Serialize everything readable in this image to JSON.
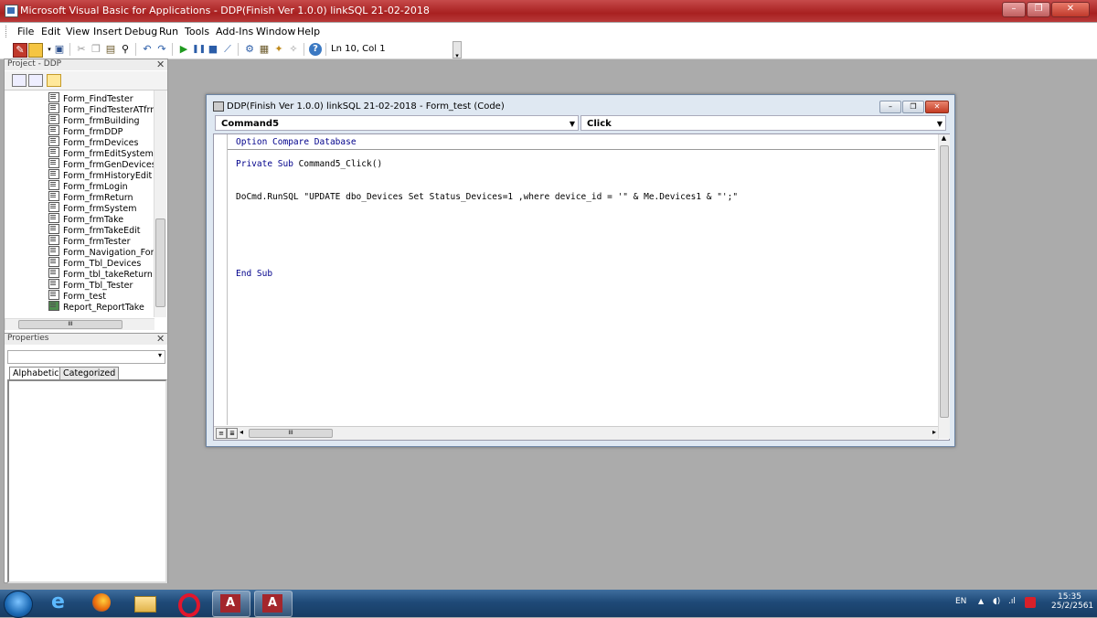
{
  "window": {
    "title": "Microsoft Visual Basic for Applications - DDP(Finish Ver 1.0.0) linkSQL 21-02-2018"
  },
  "menu": [
    "File",
    "Edit",
    "View",
    "Insert",
    "Debug",
    "Run",
    "Tools",
    "Add-Ins",
    "Window",
    "Help"
  ],
  "toolbar": {
    "position": "Ln 10, Col 1"
  },
  "project": {
    "title": "Project - DDP",
    "items": [
      "Form_FindTester",
      "Form_FindTesterATfrmD",
      "Form_frmBuilding",
      "Form_frmDDP",
      "Form_frmDevices",
      "Form_frmEditSystem",
      "Form_frmGenDevices",
      "Form_frmHistoryEdit",
      "Form_frmLogin",
      "Form_frmReturn",
      "Form_frmSystem",
      "Form_frmTake",
      "Form_frmTakeEdit",
      "Form_frmTester",
      "Form_Navigation_Form",
      "Form_Tbl_Devices",
      "Form_tbl_takeReturn",
      "Form_Tbl_Tester",
      "Form_test",
      "Report_ReportTake"
    ],
    "scroll_glyph": "III"
  },
  "properties": {
    "title": "Properties",
    "tabs": [
      "Alphabetic",
      "Categorized"
    ]
  },
  "code_window": {
    "title": "DDP(Finish Ver 1.0.0) linkSQL 21-02-2018 - Form_test (Code)",
    "object_combo": "Command5",
    "proc_combo": "Click",
    "lines": {
      "decl": "Option Compare Database",
      "sub_kw": "Private Sub",
      "sub_name": "Command5_Click()",
      "runsql": "DoCmd.RunSQL \"UPDATE dbo_Devices Set Status_Devices=1 ,where device_id = '\" & Me.Devices1 & \"';\"",
      "end": "End Sub"
    },
    "scroll_glyph": "III"
  },
  "taskbar": {
    "lang": "EN",
    "time": "15:35",
    "date": "25/2/2561",
    "apps": [
      "Internet Explorer",
      "Firefox",
      "File Explorer",
      "Opera",
      "Access",
      "Access"
    ]
  },
  "colors": {
    "keyword": "#00008b",
    "titlebar": "#b0302f",
    "workspace": "#ababab"
  }
}
